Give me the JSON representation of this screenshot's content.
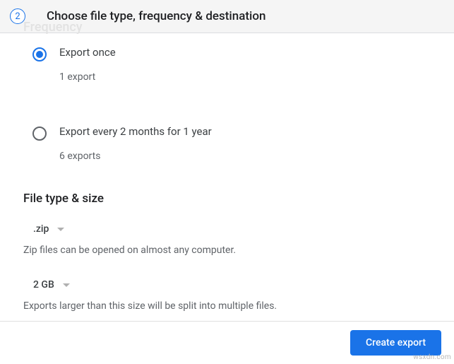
{
  "header": {
    "step": "2",
    "title": "Choose file type, frequency & destination",
    "ghost": "Frequency"
  },
  "frequency": {
    "options": [
      {
        "title": "Export once",
        "sub": "1 export",
        "selected": true
      },
      {
        "title": "Export every 2 months for 1 year",
        "sub": "6 exports",
        "selected": false
      }
    ]
  },
  "section_title": "File type & size",
  "file_type": {
    "value": ".zip",
    "hint": "Zip files can be opened on almost any computer."
  },
  "file_size": {
    "value": "2 GB",
    "hint": "Exports larger than this size will be split into multiple files."
  },
  "actions": {
    "create": "Create export"
  },
  "watermark": "wsxdn.com"
}
